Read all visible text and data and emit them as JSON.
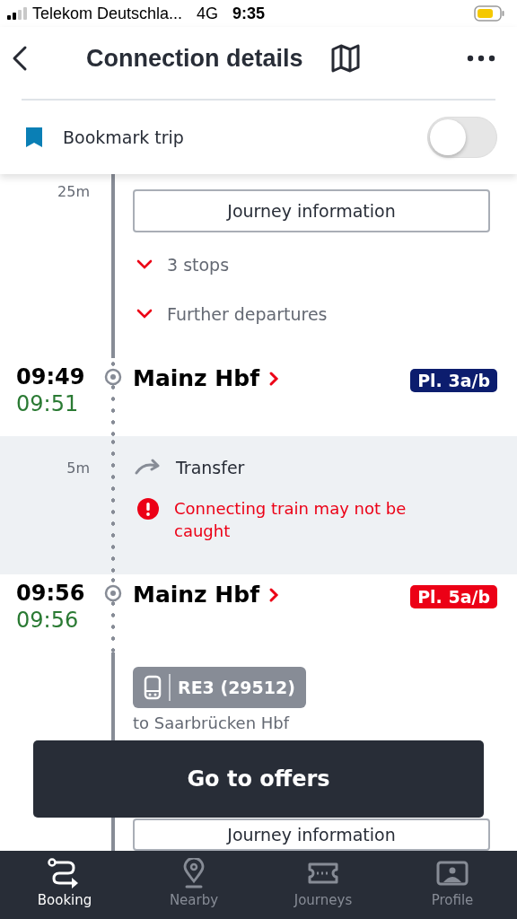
{
  "status_bar": {
    "carrier": "Telekom Deutschla...",
    "network": "4G",
    "time": "9:35"
  },
  "header": {
    "title": "Connection details"
  },
  "bookmark": {
    "label": "Bookmark trip",
    "on": false
  },
  "timeline": [
    {
      "kind": "segment",
      "duration": "25m",
      "button": "Journey information",
      "expanders": [
        "3 stops",
        "Further departures"
      ]
    },
    {
      "kind": "stop",
      "planned": "09:49",
      "actual": "09:51",
      "station": "Mainz Hbf",
      "platform": "Pl. 3a/b",
      "color": "#0c1d6e"
    },
    {
      "kind": "transfer",
      "duration": "5m",
      "label": "Transfer",
      "warning": "Connecting train may not be caught"
    },
    {
      "kind": "stop",
      "planned": "09:56",
      "actual": "09:56",
      "station": "Mainz Hbf",
      "platform": "Pl. 5a/b",
      "color": "#ec0016"
    },
    {
      "kind": "train",
      "train": "RE3 (29512)",
      "destination": "to Saarbrücken Hbf",
      "button": "Journey information"
    }
  ],
  "offers_button": "Go to offers",
  "tabs": [
    {
      "label": "Booking",
      "selected": true
    },
    {
      "label": "Nearby",
      "selected": false
    },
    {
      "label": "Journeys",
      "selected": false
    },
    {
      "label": "Profile",
      "selected": false
    }
  ]
}
